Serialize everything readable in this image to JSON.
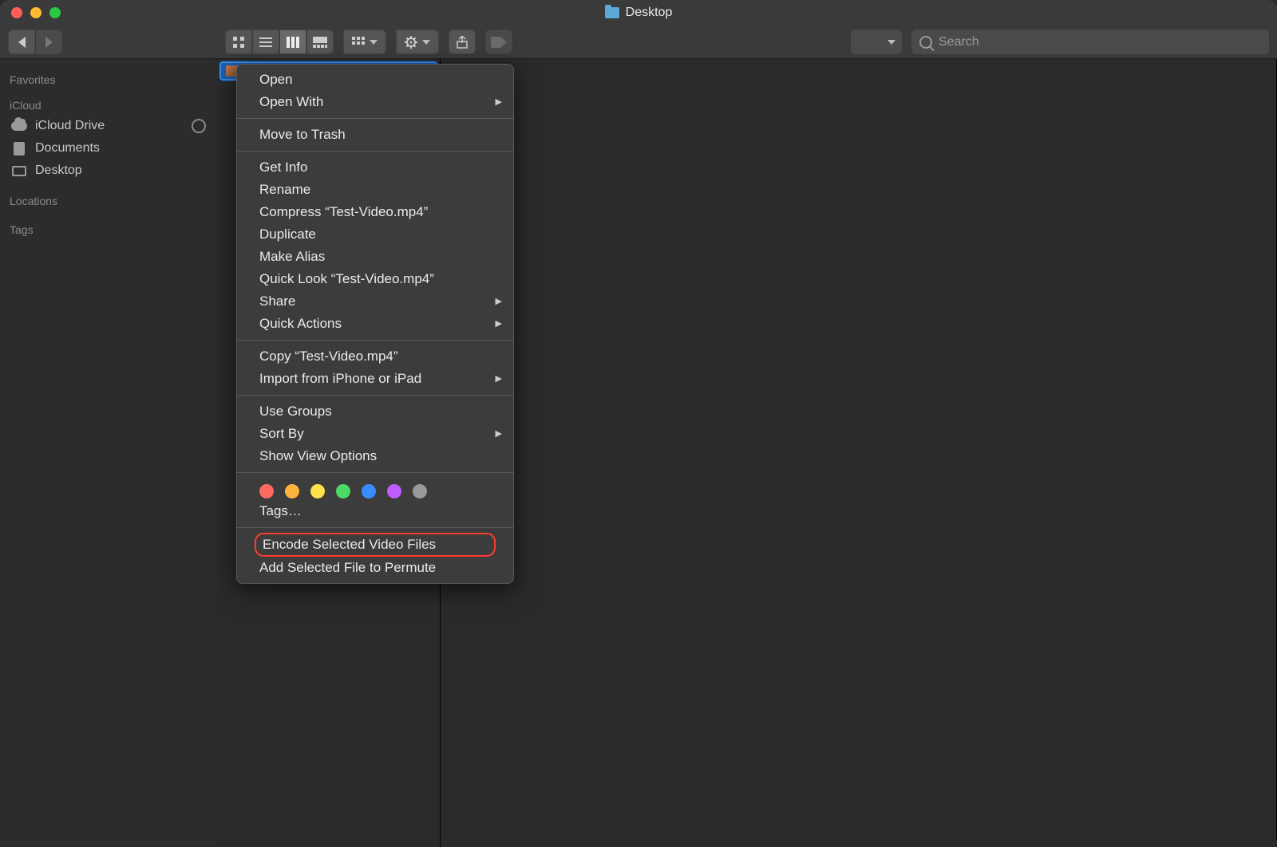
{
  "window": {
    "title": "Desktop"
  },
  "traffic_lights": {
    "close": "#ff5f57",
    "minimize": "#febc2e",
    "zoom": "#28c840"
  },
  "search": {
    "placeholder": "Search"
  },
  "sidebar": {
    "sections": {
      "favorites": {
        "header": "Favorites"
      },
      "icloud": {
        "header": "iCloud",
        "items": [
          {
            "label": "iCloud Drive",
            "icon": "cloud",
            "trailing": "pie"
          },
          {
            "label": "Documents",
            "icon": "doc"
          },
          {
            "label": "Desktop",
            "icon": "desktop"
          }
        ]
      },
      "locations": {
        "header": "Locations"
      },
      "tags": {
        "header": "Tags"
      }
    }
  },
  "selected_file": {
    "name": "Test-Video.mp4"
  },
  "context_menu": {
    "groups": [
      [
        {
          "label": "Open",
          "submenu": false
        },
        {
          "label": "Open With",
          "submenu": true
        }
      ],
      [
        {
          "label": "Move to Trash",
          "submenu": false
        }
      ],
      [
        {
          "label": "Get Info",
          "submenu": false
        },
        {
          "label": "Rename",
          "submenu": false
        },
        {
          "label": "Compress “Test-Video.mp4”",
          "submenu": false
        },
        {
          "label": "Duplicate",
          "submenu": false
        },
        {
          "label": "Make Alias",
          "submenu": false
        },
        {
          "label": "Quick Look “Test-Video.mp4”",
          "submenu": false
        },
        {
          "label": "Share",
          "submenu": true
        },
        {
          "label": "Quick Actions",
          "submenu": true
        }
      ],
      [
        {
          "label": "Copy “Test-Video.mp4”",
          "submenu": false
        },
        {
          "label": "Import from iPhone or iPad",
          "submenu": true
        }
      ],
      [
        {
          "label": "Use Groups",
          "submenu": false
        },
        {
          "label": "Sort By",
          "submenu": true
        },
        {
          "label": "Show View Options",
          "submenu": false
        }
      ]
    ],
    "tags_label": "Tags…",
    "tag_colors": [
      "#ff6b60",
      "#ffb33f",
      "#ffe14a",
      "#4cd964",
      "#3a8dff",
      "#bd5cff",
      "#9a9a9a"
    ],
    "final_group": [
      {
        "label": "Encode Selected Video Files",
        "highlight": true
      },
      {
        "label": "Add Selected File to Permute",
        "highlight": false
      }
    ]
  }
}
